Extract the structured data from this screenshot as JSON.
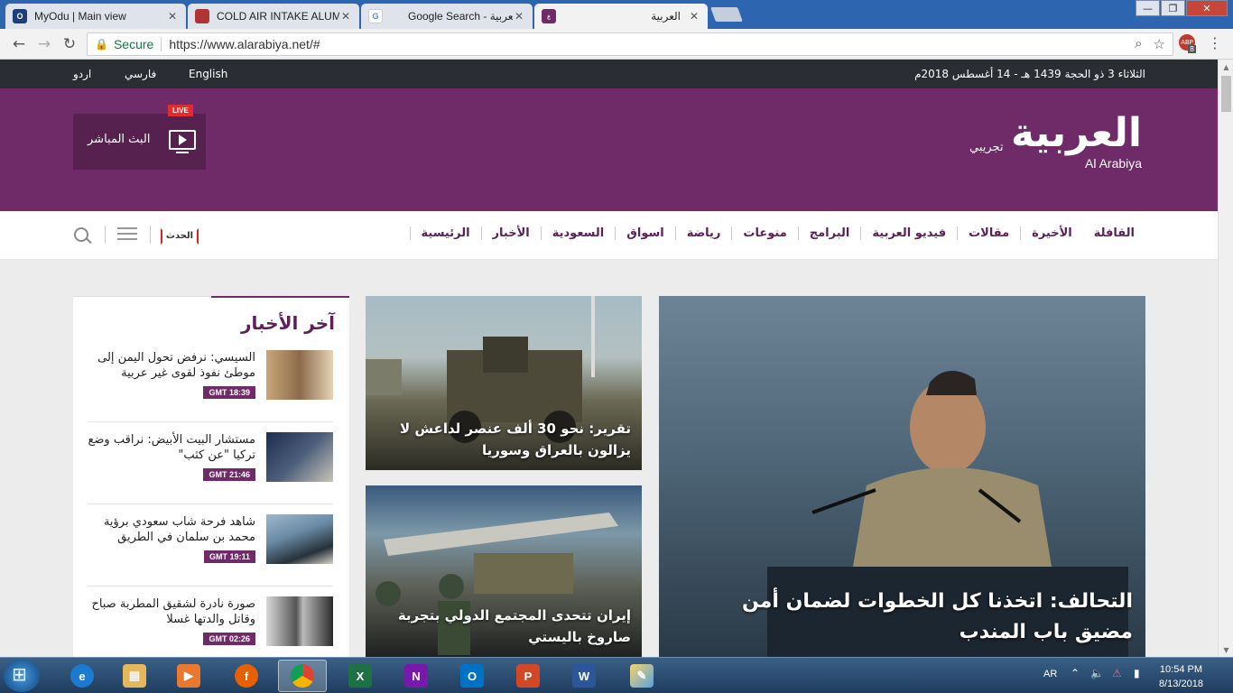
{
  "browser": {
    "tabs": [
      {
        "title": "MyOdu | Main view",
        "favicon": "odu-icon"
      },
      {
        "title": "COLD AIR INTAKE ALUMI",
        "favicon": "generic-page-icon"
      },
      {
        "title": "Google Search - العربية",
        "favicon": "google-icon"
      },
      {
        "title": "العربية",
        "favicon": "alarabiya-icon"
      }
    ],
    "secure_label": "Secure",
    "url": "https://www.alarabiya.net/#",
    "extension_badge": "8"
  },
  "topstrip": {
    "languages": [
      "English",
      "فارسي",
      "اردو"
    ],
    "date": "الثلاثاء 3 ذو الحجة 1439 هـ - 14 أغسطس 2018م"
  },
  "header": {
    "logo_arabic": "العربية",
    "logo_latin": "Al Arabiya",
    "tagline": "تجريبي",
    "live_label": "البث المباشر",
    "live_badge": "LIVE"
  },
  "nav": {
    "items": [
      "الرئيسية",
      "الأخبار",
      "السعودية",
      "اسواق",
      "رياضة",
      "منوعات",
      "البرامج",
      "فيديو العربية",
      "مقالات",
      "الأخيرة",
      "القافلة"
    ],
    "hadath_logo": "الحدث"
  },
  "latest": {
    "heading": "آخر الأخبار",
    "items": [
      {
        "title": "السيسي: نرفض تحول اليمن إلى موطئ نفوذ لقوى غير عربية",
        "time": "GMT 18:39"
      },
      {
        "title": "مستشار البيت الأبيض: نراقب وضع تركيا \"عن كثب\"",
        "time": "GMT 21:46"
      },
      {
        "title": "شاهد فرحة شاب سعودي برؤية محمد بن سلمان في الطريق",
        "time": "GMT 19:11"
      },
      {
        "title": "صورة نادرة لشقيق المطربة صباح وقاتل والدتها غسلا",
        "time": "GMT 02:26"
      }
    ]
  },
  "stories": {
    "s1": "تقرير: نحو 30 ألف عنصر لداعش لا يزالون بالعراق وسوريا",
    "s2": "إيران تتحدى المجتمع الدولي بتجربة صاروخ باليستي",
    "main": "التحالف: اتخذنا كل الخطوات لضمان أمن مضيق باب المندب"
  },
  "taskbar": {
    "lang": "AR",
    "time": "10:54 PM",
    "date": "8/13/2018",
    "apps": [
      "internet-explorer-icon",
      "file-explorer-icon",
      "media-player-icon",
      "firefox-icon",
      "chrome-icon",
      "excel-icon",
      "onenote-icon",
      "outlook-icon",
      "powerpoint-icon",
      "word-icon",
      "paint-icon"
    ]
  },
  "colors": {
    "brand": "#6f2a68",
    "dark_strip": "#2a2e33",
    "live_red": "#e42b2b"
  }
}
